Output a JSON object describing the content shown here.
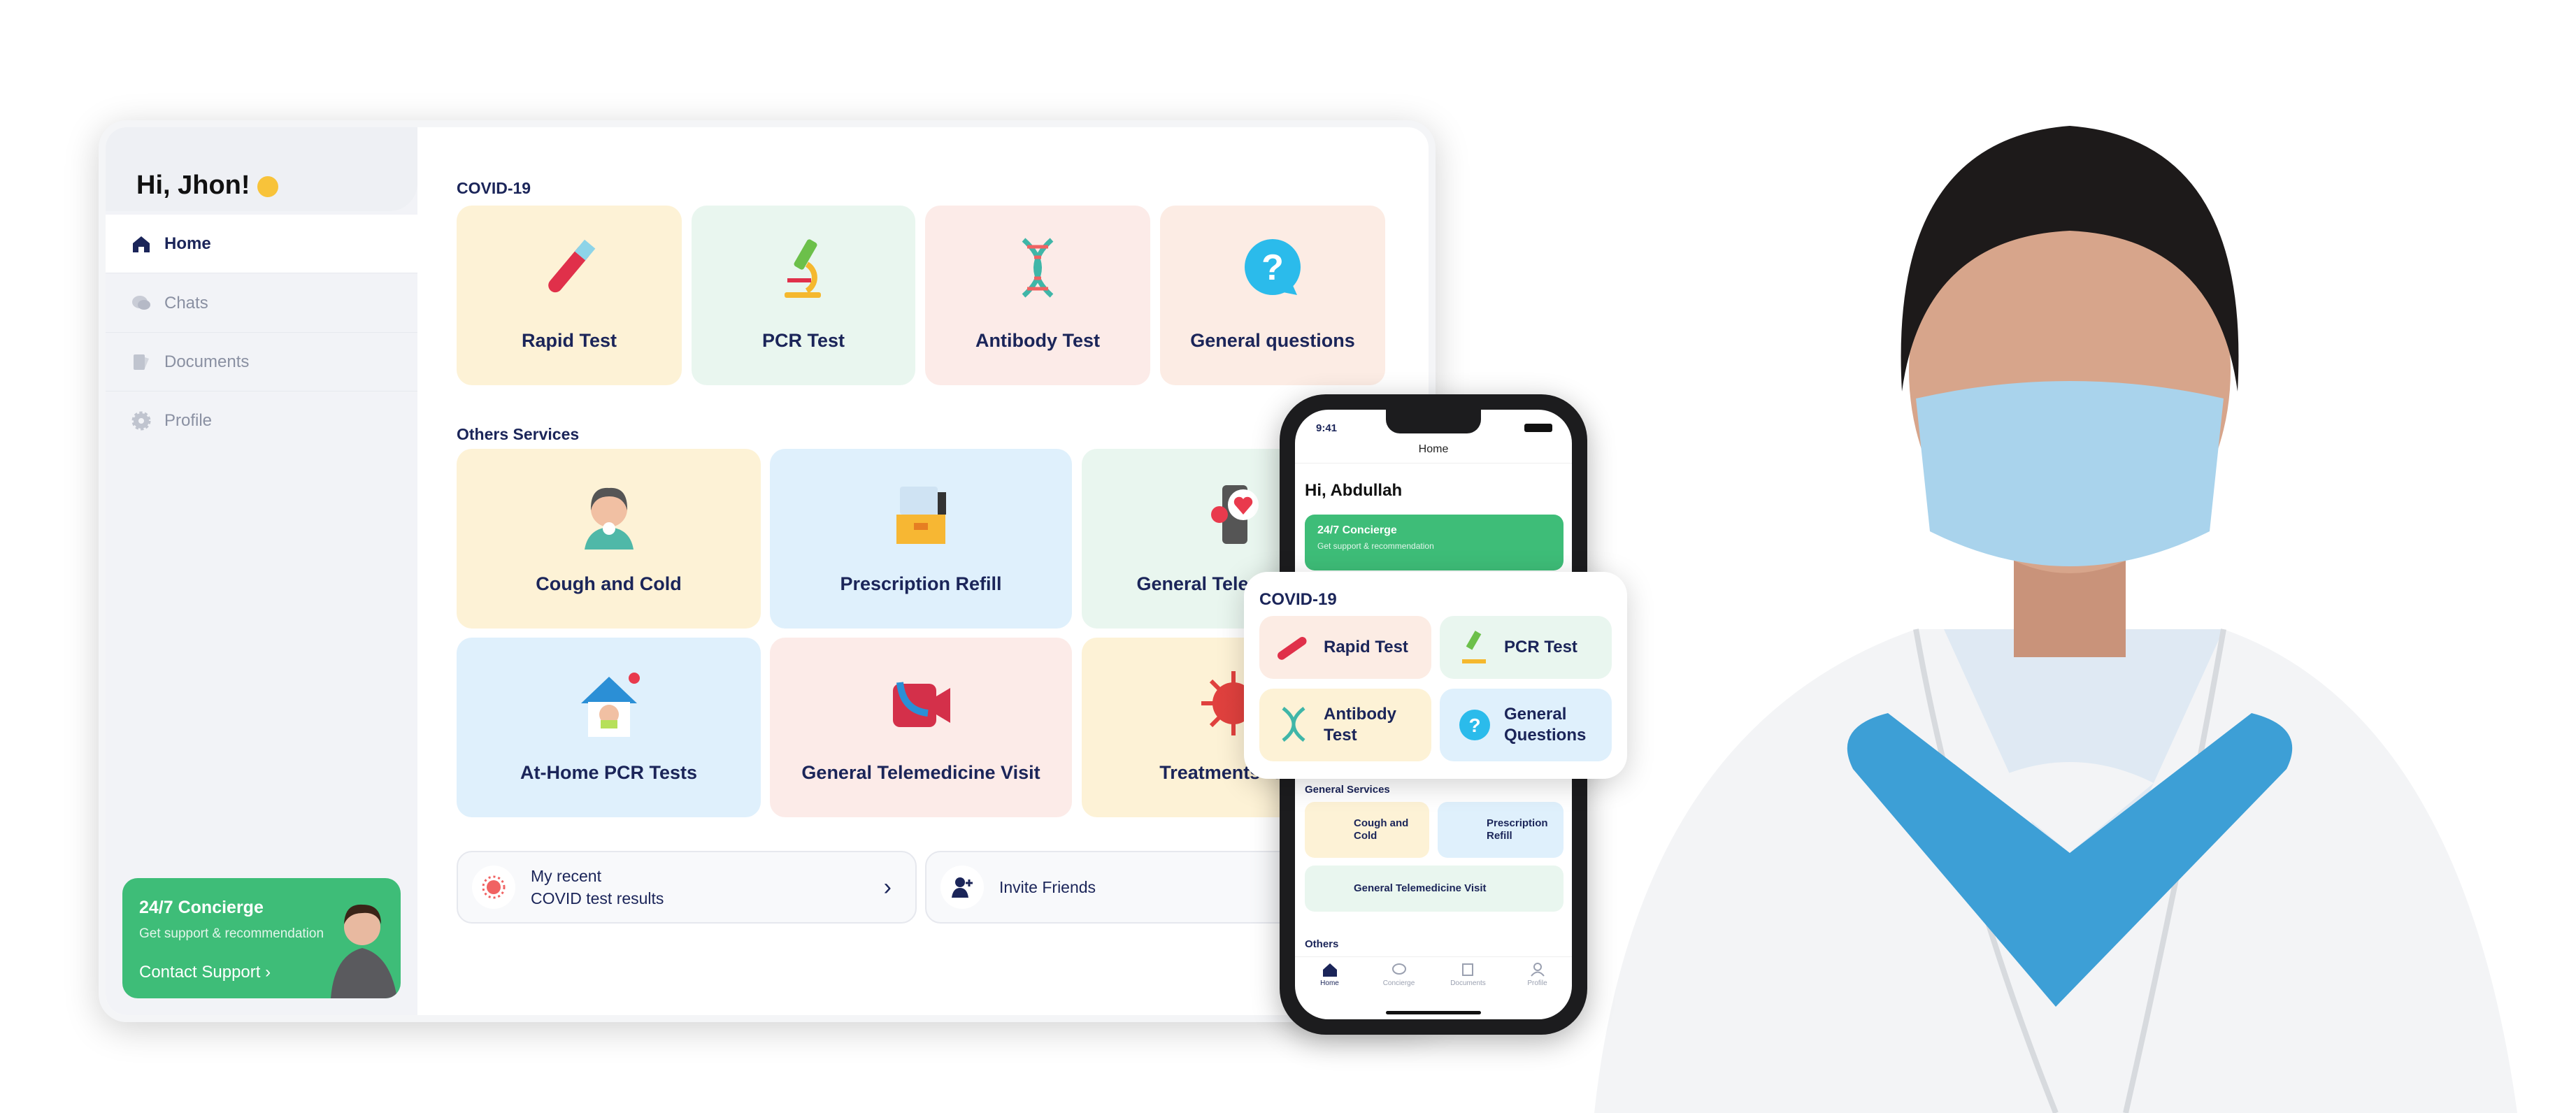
{
  "tablet": {
    "greeting": "Hi, Jhon!",
    "nav": [
      {
        "label": "Home",
        "icon": "home-icon",
        "active": true
      },
      {
        "label": "Chats",
        "icon": "chat-icon"
      },
      {
        "label": "Documents",
        "icon": "document-icon"
      },
      {
        "label": "Profile",
        "icon": "gear-icon"
      }
    ],
    "concierge": {
      "title": "24/7 Concierge",
      "subtitle": "Get support & recommendation",
      "link": "Contact Support"
    },
    "covid_title": "COVID-19",
    "covid": [
      {
        "label": "Rapid Test",
        "icon": "test-tube-icon"
      },
      {
        "label": "PCR Test",
        "icon": "microscope-icon"
      },
      {
        "label": "Antibody Test",
        "icon": "dna-icon"
      },
      {
        "label": "General questions",
        "icon": "question-icon"
      }
    ],
    "others_title": "Others Services",
    "services": [
      {
        "label": "Cough and Cold",
        "icon": "sick-person-icon"
      },
      {
        "label": "Prescription Refill",
        "icon": "pill-box-icon"
      },
      {
        "label": "General Telemedicine",
        "icon": "phone-heart-icon"
      },
      {
        "label": "At-Home PCR Tests",
        "icon": "home-test-icon"
      },
      {
        "label": "General Telemedicine Visit",
        "icon": "video-call-icon"
      },
      {
        "label": "Treatments for L",
        "icon": "virus-icon"
      }
    ],
    "recent": {
      "line1": "My recent",
      "line2": "COVID test results"
    },
    "invite": "Invite Friends"
  },
  "phone": {
    "time": "9:41",
    "title": "Home",
    "greeting": "Hi, Abdullah",
    "concierge": {
      "title": "24/7 Concierge",
      "subtitle": "Get support & recommendation"
    },
    "covid_title": "COVID-19",
    "covid": [
      "Rapid Test",
      "PCR Test",
      "Antibody Test",
      "General Questions"
    ],
    "general_title": "General Services",
    "general": [
      "Cough and Cold",
      "Prescription Refill",
      "General Telemedicine Visit"
    ],
    "others_title": "Others",
    "tabs": [
      {
        "label": "Home",
        "active": true
      },
      {
        "label": "Concierge"
      },
      {
        "label": "Documents"
      },
      {
        "label": "Profile"
      }
    ]
  },
  "colors": {
    "navy": "#1b2559",
    "green": "#3ebd78",
    "glove": "#3d9fd6",
    "mask": "#a9d3ec"
  }
}
